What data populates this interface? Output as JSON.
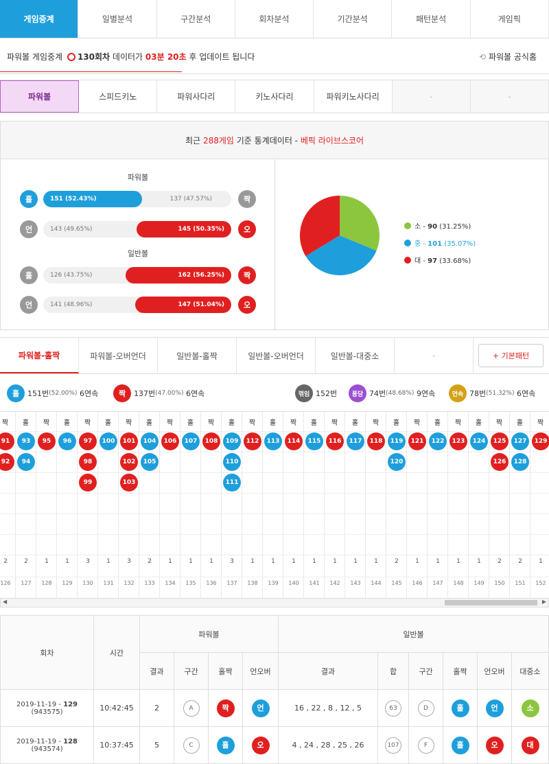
{
  "topnav": [
    "게임중계",
    "일별분석",
    "구간분석",
    "회차분석",
    "기간분석",
    "패턴분석",
    "게임픽"
  ],
  "status": {
    "prefix": "파워볼 게임중계",
    "round": "130회차",
    "mid": "데이터가",
    "countdown": "03분 20초",
    "suffix": "후 업데이트 됩니다",
    "official_link": "파워볼 공식홈"
  },
  "gametabs": [
    "파워볼",
    "스피드키노",
    "파워사다리",
    "키노사다리",
    "파워키노사다리",
    "-",
    "-"
  ],
  "stats": {
    "head_pre": "최근",
    "head_count": "288게임",
    "head_mid": "기준 통계데이터 -",
    "head_brand": "베픽 라이브스코어",
    "powerball_title": "파워볼",
    "normal_title": "일반볼",
    "pb_oddeven": {
      "left_icon": "홀",
      "left": "151",
      "left_pct": "(52.43%)",
      "right": "137",
      "right_pct": "(47.57%)",
      "right_icon": "짝",
      "left_frac": 0.5243
    },
    "pb_underover": {
      "left_icon": "언",
      "left": "143",
      "left_pct": "(49.65%)",
      "right": "145",
      "right_pct": "(50.35%)",
      "right_icon": "오",
      "right_frac": 0.5035
    },
    "nb_oddeven": {
      "left_icon": "홀",
      "left": "126",
      "left_pct": "(43.75%)",
      "right": "162",
      "right_pct": "(56.25%)",
      "right_icon": "짝",
      "right_frac": 0.5625
    },
    "nb_underover": {
      "left_icon": "언",
      "left": "141",
      "left_pct": "(48.96%)",
      "right": "147",
      "right_pct": "(51.04%)",
      "right_icon": "오",
      "right_frac": 0.5104
    },
    "pie_legend": [
      {
        "label": "소",
        "value": "90",
        "pct": "(31.25%)",
        "color": "#8cc63f"
      },
      {
        "label": "중",
        "value": "101",
        "pct": "(35.07%)",
        "color": "#1e9fdb"
      },
      {
        "label": "대",
        "value": "97",
        "pct": "(33.68%)",
        "color": "#e02020"
      }
    ]
  },
  "pattern_tabs": [
    "파워볼-홀짝",
    "파워볼-오버언더",
    "일반볼-홀짝",
    "일반볼-오버언더",
    "일반볼-대중소",
    "-"
  ],
  "basic_pattern": "+ 기본패턴",
  "summary": {
    "odd": {
      "icon": "홀",
      "count": "151번",
      "pct": "(52.00%)",
      "streak": "6연속"
    },
    "even": {
      "icon": "짝",
      "count": "137번",
      "pct": "(47.00%)",
      "streak": "6연속"
    },
    "break": {
      "icon": "꺾임",
      "count": "152번"
    },
    "pong": {
      "icon": "퐁당",
      "count": "74번",
      "pct": "(48.68%)",
      "streak": "9연속"
    },
    "cons": {
      "icon": "연속",
      "count": "78번",
      "pct": "(51.32%)",
      "streak": "6연속"
    }
  },
  "pattern_cols": [
    {
      "h": "짝",
      "t": "e",
      "vals": [
        "91",
        "92"
      ],
      "cnt": "2",
      "rnd": "126"
    },
    {
      "h": "홀",
      "t": "o",
      "vals": [
        "93",
        "94"
      ],
      "cnt": "2",
      "rnd": "127"
    },
    {
      "h": "짝",
      "t": "e",
      "vals": [
        "95"
      ],
      "cnt": "1",
      "rnd": "128"
    },
    {
      "h": "홀",
      "t": "o",
      "vals": [
        "96"
      ],
      "cnt": "1",
      "rnd": "129"
    },
    {
      "h": "짝",
      "t": "e",
      "vals": [
        "97",
        "98",
        "99"
      ],
      "cnt": "3",
      "rnd": "130"
    },
    {
      "h": "홀",
      "t": "o",
      "vals": [
        "100"
      ],
      "cnt": "1",
      "rnd": "131"
    },
    {
      "h": "짝",
      "t": "e",
      "vals": [
        "101",
        "102",
        "103"
      ],
      "cnt": "3",
      "rnd": "132"
    },
    {
      "h": "홀",
      "t": "o",
      "vals": [
        "104",
        "105"
      ],
      "cnt": "2",
      "rnd": "133"
    },
    {
      "h": "짝",
      "t": "e",
      "vals": [
        "106"
      ],
      "cnt": "1",
      "rnd": "134"
    },
    {
      "h": "홀",
      "t": "o",
      "vals": [
        "107"
      ],
      "cnt": "1",
      "rnd": "135"
    },
    {
      "h": "짝",
      "t": "e",
      "vals": [
        "108"
      ],
      "cnt": "1",
      "rnd": "136"
    },
    {
      "h": "홀",
      "t": "o",
      "vals": [
        "109",
        "110",
        "111"
      ],
      "cnt": "3",
      "rnd": "137"
    },
    {
      "h": "짝",
      "t": "e",
      "vals": [
        "112"
      ],
      "cnt": "1",
      "rnd": "138"
    },
    {
      "h": "홀",
      "t": "o",
      "vals": [
        "113"
      ],
      "cnt": "1",
      "rnd": "139"
    },
    {
      "h": "짝",
      "t": "e",
      "vals": [
        "114"
      ],
      "cnt": "1",
      "rnd": "140"
    },
    {
      "h": "홀",
      "t": "o",
      "vals": [
        "115"
      ],
      "cnt": "1",
      "rnd": "141"
    },
    {
      "h": "짝",
      "t": "e",
      "vals": [
        "116"
      ],
      "cnt": "1",
      "rnd": "142"
    },
    {
      "h": "홀",
      "t": "o",
      "vals": [
        "117"
      ],
      "cnt": "1",
      "rnd": "143"
    },
    {
      "h": "짝",
      "t": "e",
      "vals": [
        "118"
      ],
      "cnt": "1",
      "rnd": "144"
    },
    {
      "h": "홀",
      "t": "o",
      "vals": [
        "119",
        "120"
      ],
      "cnt": "2",
      "rnd": "145"
    },
    {
      "h": "짝",
      "t": "e",
      "vals": [
        "121"
      ],
      "cnt": "1",
      "rnd": "146"
    },
    {
      "h": "홀",
      "t": "o",
      "vals": [
        "122"
      ],
      "cnt": "1",
      "rnd": "147"
    },
    {
      "h": "짝",
      "t": "e",
      "vals": [
        "123"
      ],
      "cnt": "1",
      "rnd": "148"
    },
    {
      "h": "홀",
      "t": "o",
      "vals": [
        "124"
      ],
      "cnt": "1",
      "rnd": "149"
    },
    {
      "h": "짝",
      "t": "e",
      "vals": [
        "125",
        "126"
      ],
      "cnt": "2",
      "rnd": "150"
    },
    {
      "h": "홀",
      "t": "o",
      "vals": [
        "127",
        "128"
      ],
      "cnt": "2",
      "rnd": "151"
    },
    {
      "h": "짝",
      "t": "e",
      "vals": [
        "129"
      ],
      "cnt": "1",
      "rnd": "152"
    }
  ],
  "table": {
    "h_round": "회차",
    "h_time": "시간",
    "h_power": "파워볼",
    "h_normal": "일반볼",
    "sub": [
      "결과",
      "구간",
      "홀짝",
      "언오버",
      "결과",
      "합",
      "구간",
      "홀짝",
      "언오버",
      "대중소"
    ],
    "rows": [
      {
        "date": "2019-11-19 -",
        "round": "129",
        "id": "(943575)",
        "time": "10:42:45",
        "pres": "2",
        "psec": "A",
        "poe": "짝",
        "pou": "언",
        "nres": "16 , 22 , 8 , 12 , 5",
        "sum": "63",
        "nsec": "D",
        "noe": "홀",
        "nou": "언",
        "size": "소"
      },
      {
        "date": "2019-11-19 -",
        "round": "128",
        "id": "(943574)",
        "time": "10:37:45",
        "pres": "5",
        "psec": "C",
        "poe": "홀",
        "pou": "오",
        "nres": "4 , 24 , 28 , 25 , 26",
        "sum": "107",
        "nsec": "F",
        "noe": "홀",
        "nou": "오",
        "size": "대"
      }
    ]
  }
}
